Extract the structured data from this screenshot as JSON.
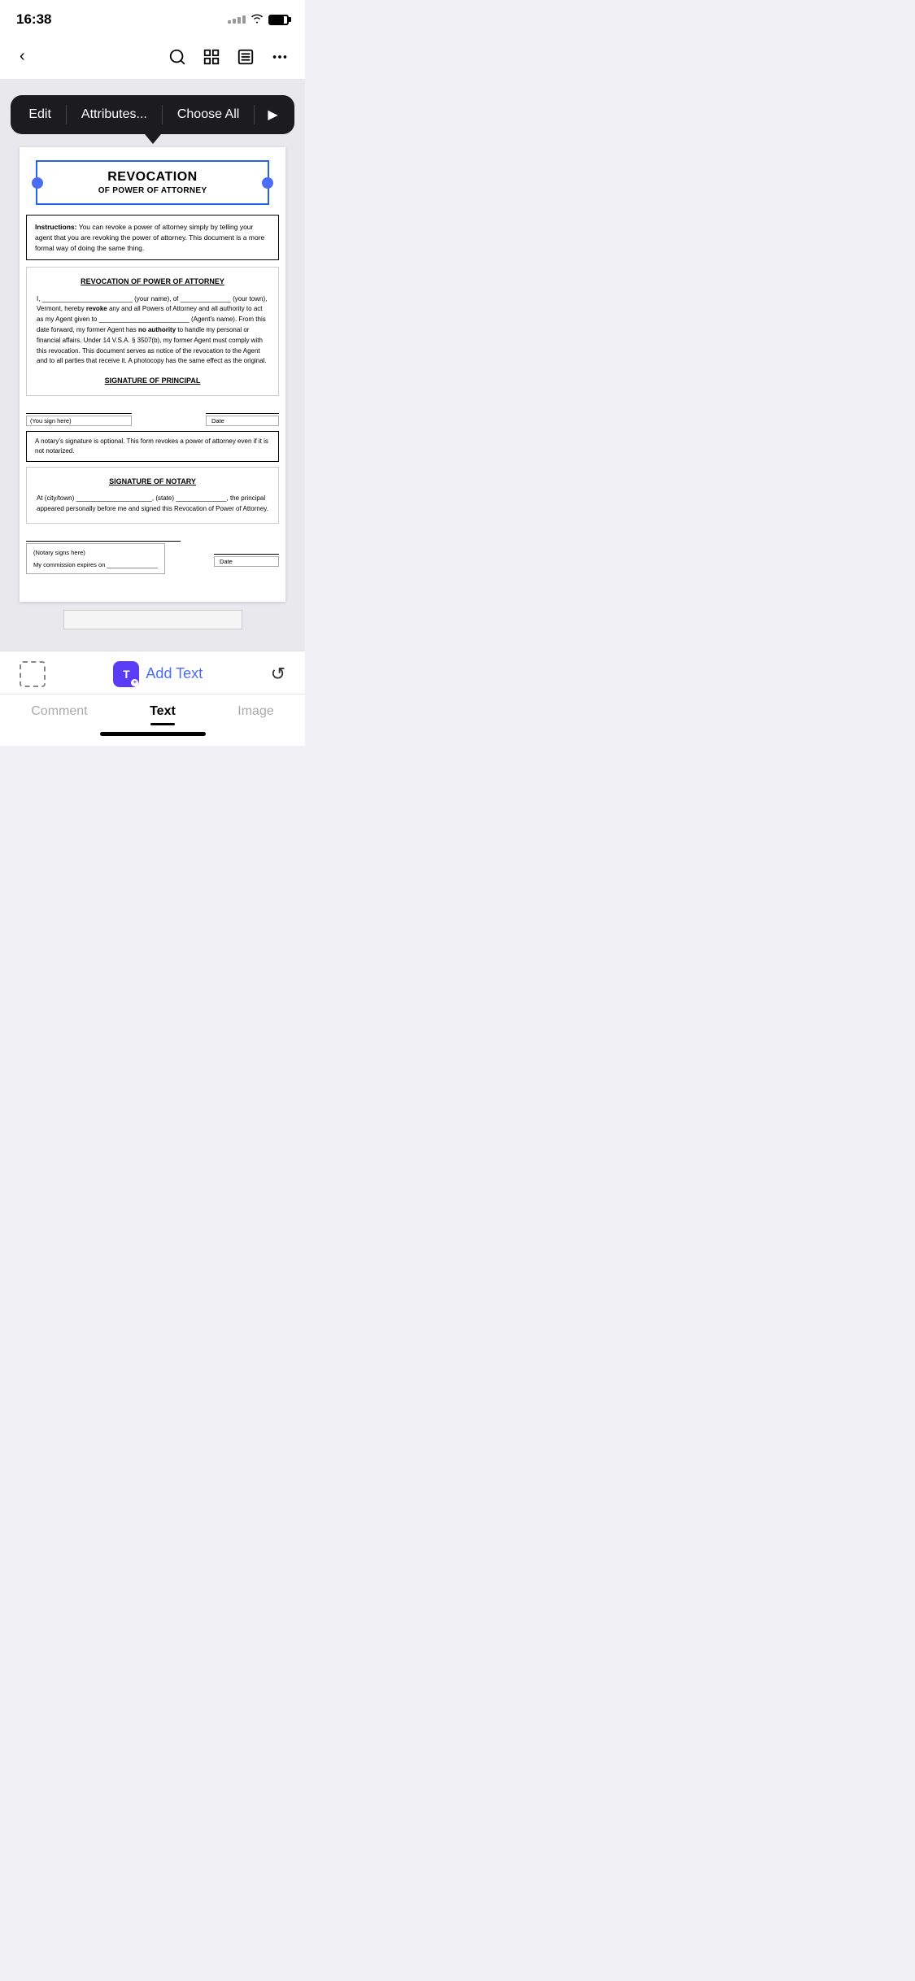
{
  "statusBar": {
    "time": "16:38"
  },
  "topNav": {
    "backLabel": "‹",
    "searchIcon": "search",
    "gridIcon": "grid",
    "listIcon": "list",
    "moreIcon": "more"
  },
  "contextMenu": {
    "items": [
      {
        "label": "Edit",
        "id": "edit"
      },
      {
        "label": "Attributes...",
        "id": "attributes"
      },
      {
        "label": "Choose All",
        "id": "choose-all"
      }
    ],
    "playIcon": "▶"
  },
  "document": {
    "titleMain": "REVOCATION",
    "titleSub": "OF POWER OF ATTORNEY",
    "instructions": {
      "prefix": "Instructions:",
      "text": " You can revoke a power of attorney simply by telling your agent that you are revoking the power of attorney.  This document is a more formal way of doing the same thing."
    },
    "mainSectionTitle": "REVOCATION OF POWER OF ATTORNEY",
    "bodyParagraph1": "I, _________________________ (your name), of ______________ (your town), Vermont, hereby revoke any and all Powers of Attorney and all authority to act as my Agent given to _________________________ (Agent's name).  From this date forward, my former Agent has no authority to handle my personal or financial affairs.  Under 14 V.S.A. § 3507(b), my former Agent must comply with this revocation. This document serves as notice of the revocation to the Agent and to all parties that receive it.  A photocopy has the same effect as the original.",
    "sigPrincipalTitle": "SIGNATURE OF PRINCIPAL",
    "youSignHere": "(You sign here)",
    "dateLabel": "Date",
    "notaryNote": "A notary's signature is optional.  This form revokes a power of attorney even if it is not notarized.",
    "sigNotaryTitle": "SIGNATURE OF NOTARY",
    "notaryText": "At (city/town) _____________________, (state) ______________, the principal appeared personally before me and signed this Revocation of Power of Attorney.",
    "notarySigns": "(Notary signs here)",
    "notaryDate": "Date",
    "commissionExpires": "My commission expires on _______________"
  },
  "bottomToolbar": {
    "selectionToolLabel": "selection",
    "addTextLabel": "Add Text",
    "addTextIconLetter": "T",
    "undoIcon": "↺"
  },
  "tabBar": {
    "tabs": [
      {
        "label": "Comment",
        "id": "comment",
        "active": false
      },
      {
        "label": "Text",
        "id": "text",
        "active": true
      },
      {
        "label": "Image",
        "id": "image",
        "active": false
      }
    ]
  }
}
